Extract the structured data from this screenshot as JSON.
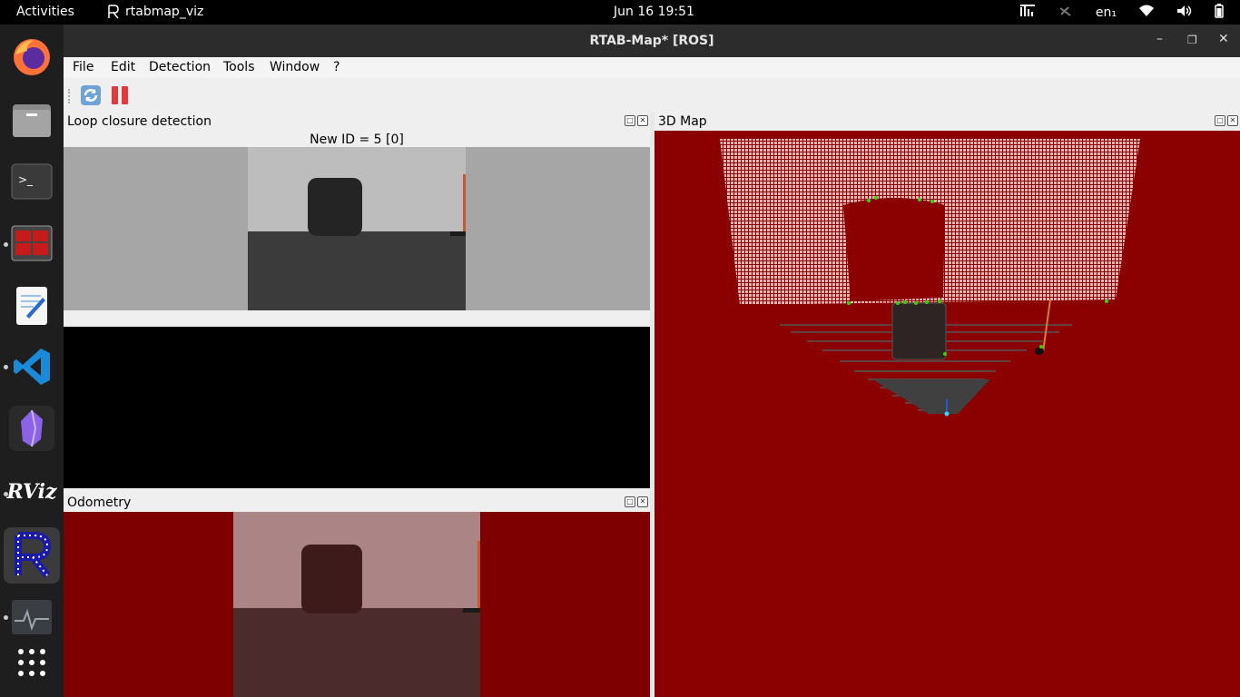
{
  "topbar": {
    "activities": "Activities",
    "app_name": "rtabmap_viz",
    "clock": "Jun 16  19:51",
    "input_method": "en₁"
  },
  "dock": {
    "items": [
      "firefox-icon",
      "files-icon",
      "terminal-icon",
      "terminator-icon",
      "text-editor-icon",
      "vscode-icon",
      "obsidian-icon",
      "rviz-icon",
      "rtabmap-icon",
      "system-monitor-icon",
      "show-apps-icon"
    ],
    "rviz_label": "RViz"
  },
  "window": {
    "title": "RTAB-Map* [ROS]",
    "menu": [
      "File",
      "Edit",
      "Detection",
      "Tools",
      "Window",
      "?"
    ]
  },
  "panels": {
    "loop_closure": {
      "title": "Loop closure detection",
      "new_id": "New ID = 5 [0]"
    },
    "odometry": {
      "title": "Odometry"
    },
    "map3d": {
      "title": "3D Map"
    }
  },
  "colors": {
    "map_background": "#8b0000",
    "odometry_background": "#7f0000",
    "cloud_points": "#e8b4b4",
    "feature_points": "#39d400"
  }
}
